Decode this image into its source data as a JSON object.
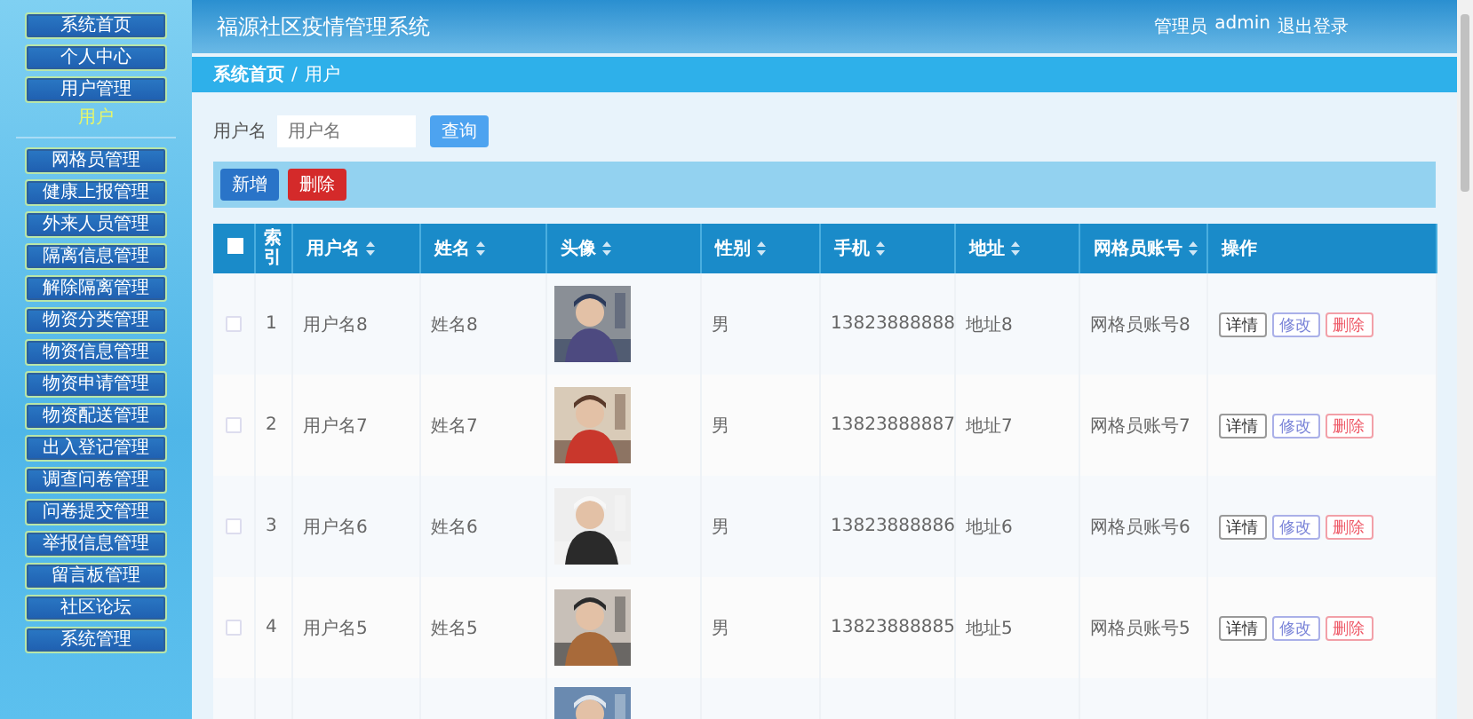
{
  "sidebar": {
    "items": [
      {
        "label": "系统首页",
        "selected": false
      },
      {
        "label": "个人中心",
        "selected": false
      },
      {
        "label": "用户管理",
        "selected": false,
        "children": [
          {
            "label": "用户",
            "selected": true
          }
        ]
      },
      {
        "label": "网格员管理",
        "selected": false
      },
      {
        "label": "健康上报管理",
        "selected": false
      },
      {
        "label": "外来人员管理",
        "selected": false
      },
      {
        "label": "隔离信息管理",
        "selected": false
      },
      {
        "label": "解除隔离管理",
        "selected": false
      },
      {
        "label": "物资分类管理",
        "selected": false
      },
      {
        "label": "物资信息管理",
        "selected": false
      },
      {
        "label": "物资申请管理",
        "selected": false
      },
      {
        "label": "物资配送管理",
        "selected": false
      },
      {
        "label": "出入登记管理",
        "selected": false
      },
      {
        "label": "调查问卷管理",
        "selected": false
      },
      {
        "label": "问卷提交管理",
        "selected": false
      },
      {
        "label": "举报信息管理",
        "selected": false
      },
      {
        "label": "留言板管理",
        "selected": false
      },
      {
        "label": "社区论坛",
        "selected": false
      },
      {
        "label": "系统管理",
        "selected": false
      }
    ]
  },
  "header": {
    "title": "福源社区疫情管理系统",
    "user_role": "管理员",
    "user_name": "admin",
    "logout": "退出登录"
  },
  "breadcrumb": {
    "items": [
      "系统首页",
      "用户"
    ],
    "separator": "/"
  },
  "search": {
    "label": "用户名",
    "placeholder": "用户名",
    "button": "查询"
  },
  "toolbar": {
    "buttons": [
      {
        "label": "新增",
        "kind": "add"
      },
      {
        "label": "删除",
        "kind": "delete"
      }
    ]
  },
  "table": {
    "select_all": {
      "checked": false
    },
    "columns": [
      {
        "label": "索引",
        "sortable": false
      },
      {
        "label": "用户名",
        "sortable": true
      },
      {
        "label": "姓名",
        "sortable": true
      },
      {
        "label": "头像",
        "sortable": true
      },
      {
        "label": "性别",
        "sortable": true
      },
      {
        "label": "手机",
        "sortable": true
      },
      {
        "label": "地址",
        "sortable": true
      },
      {
        "label": "网格员账号",
        "sortable": true
      },
      {
        "label": "操作",
        "sortable": false
      }
    ],
    "rows": [
      {
        "checked": false,
        "index": "1",
        "username": "用户名8",
        "name": "姓名8",
        "avatar": {
          "kind": "picture"
        },
        "gender": "男",
        "phone": "13823888888",
        "address": "地址8",
        "grid_account": "网格员账号8",
        "actions": [
          {
            "label": "详情",
            "kind": "detail"
          },
          {
            "label": "修改",
            "kind": "edit"
          },
          {
            "label": "删除",
            "kind": "delete"
          }
        ]
      },
      {
        "checked": false,
        "index": "2",
        "username": "用户名7",
        "name": "姓名7",
        "avatar": {
          "kind": "picture"
        },
        "gender": "男",
        "phone": "13823888887",
        "address": "地址7",
        "grid_account": "网格员账号7",
        "actions": [
          {
            "label": "详情",
            "kind": "detail"
          },
          {
            "label": "修改",
            "kind": "edit"
          },
          {
            "label": "删除",
            "kind": "delete"
          }
        ]
      },
      {
        "checked": false,
        "index": "3",
        "username": "用户名6",
        "name": "姓名6",
        "avatar": {
          "kind": "picture"
        },
        "gender": "男",
        "phone": "13823888886",
        "address": "地址6",
        "grid_account": "网格员账号6",
        "actions": [
          {
            "label": "详情",
            "kind": "detail"
          },
          {
            "label": "修改",
            "kind": "edit"
          },
          {
            "label": "删除",
            "kind": "delete"
          }
        ]
      },
      {
        "checked": false,
        "index": "4",
        "username": "用户名5",
        "name": "姓名5",
        "avatar": {
          "kind": "picture"
        },
        "gender": "男",
        "phone": "13823888885",
        "address": "地址5",
        "grid_account": "网格员账号5",
        "actions": [
          {
            "label": "详情",
            "kind": "detail"
          },
          {
            "label": "修改",
            "kind": "edit"
          },
          {
            "label": "删除",
            "kind": "delete"
          }
        ]
      },
      {
        "avatar": {
          "kind": "picture"
        }
      }
    ]
  }
}
